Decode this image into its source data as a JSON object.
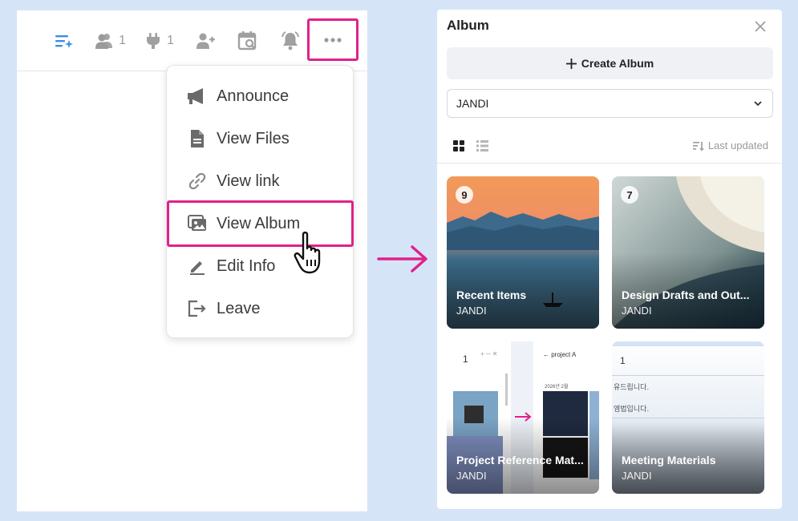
{
  "toolbar": {
    "members_count": "1",
    "integrations_count": "1"
  },
  "menu": {
    "items": [
      {
        "label": "Announce"
      },
      {
        "label": "View Files"
      },
      {
        "label": "View link"
      },
      {
        "label": "View Album"
      },
      {
        "label": "Edit Info"
      },
      {
        "label": "Leave"
      }
    ]
  },
  "album_panel": {
    "title": "Album",
    "create_label": "Create Album",
    "team_select": "JANDI",
    "sort_label": "Last updated",
    "cards": [
      {
        "count": "9",
        "title": "Recent Items",
        "team": "JANDI"
      },
      {
        "count": "7",
        "title": "Design Drafts and Out...",
        "team": "JANDI"
      },
      {
        "count": "1",
        "title": "Project Reference Mat...",
        "team": "JANDI",
        "preview": {
          "date": "2026년 2월",
          "project": "project A"
        }
      },
      {
        "count": "1",
        "title": "Meeting Materials",
        "team": "JANDI",
        "preview": {
          "line1": "유드립니다.",
          "line2": "엠법입니다."
        }
      }
    ]
  },
  "colors": {
    "highlight": "#e0218a",
    "background": "#d6e4f7",
    "accent_blue": "#3b8fe0"
  }
}
